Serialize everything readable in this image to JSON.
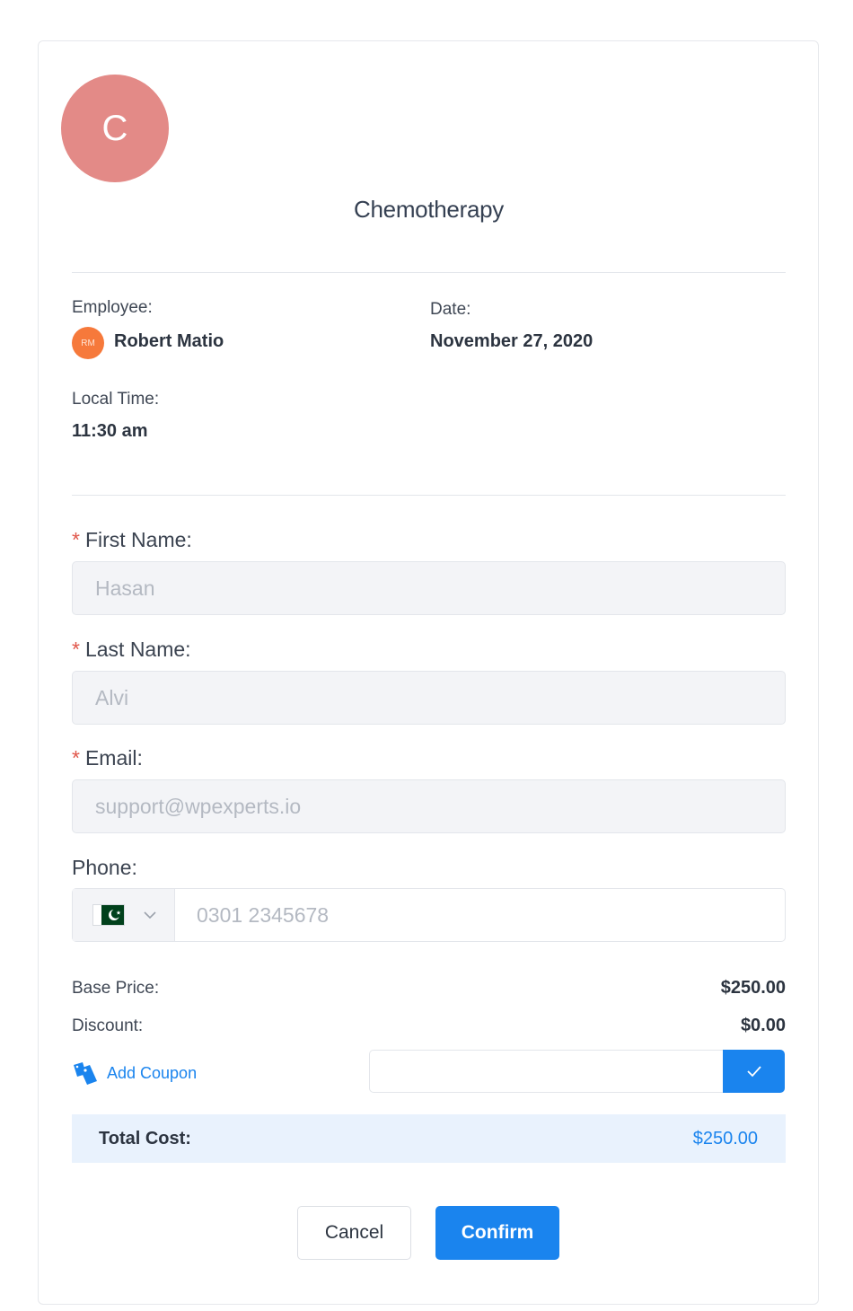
{
  "service": {
    "avatar_letter": "C",
    "title": "Chemotherapy"
  },
  "details": {
    "employee_label": "Employee:",
    "employee_initials": "RM",
    "employee_name": "Robert Matio",
    "date_label": "Date:",
    "date_value": "November 27, 2020",
    "local_time_label": "Local Time:",
    "local_time_value": "11:30 am"
  },
  "form": {
    "required_mark": "*",
    "first_name_label": "First Name:",
    "first_name_value": "Hasan",
    "last_name_label": "Last Name:",
    "last_name_value": "Alvi",
    "email_label": "Email:",
    "email_value": "support@wpexperts.io",
    "phone_label": "Phone:",
    "phone_placeholder": "0301 2345678",
    "phone_country": "Pakistan"
  },
  "pricing": {
    "base_price_label": "Base Price:",
    "base_price_value": "$250.00",
    "discount_label": "Discount:",
    "discount_value": "$0.00",
    "add_coupon_label": "Add Coupon",
    "total_label": "Total Cost:",
    "total_value": "$250.00"
  },
  "actions": {
    "cancel_label": "Cancel",
    "confirm_label": "Confirm"
  },
  "colors": {
    "accent": "#1a84ee",
    "service_avatar": "#e38a87",
    "employee_avatar": "#f6793b",
    "required": "#e0564a",
    "total_bg": "#e9f2fd"
  }
}
